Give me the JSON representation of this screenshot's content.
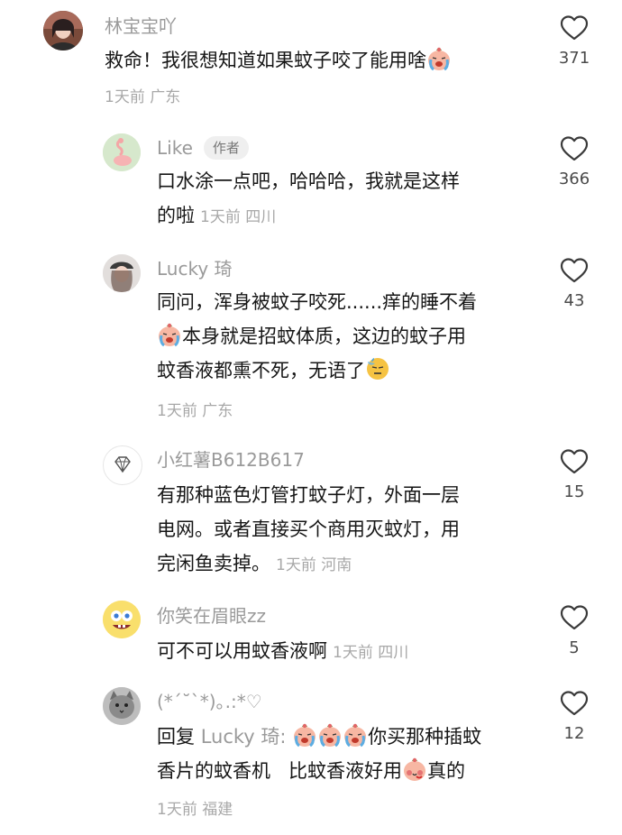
{
  "comments": [
    {
      "user": "林宝宝吖",
      "text": "救命！我很想知道如果蚊子咬了能用啥",
      "meta": "1天前 广东",
      "likes": "371",
      "avatar_icon": "user-photo-avatar"
    },
    {
      "user": "Like",
      "tag": "作者",
      "text_line1": "口水涂一点吧，哈哈哈，我就是这样",
      "text_line2": "的啦",
      "meta": "1天前 四川",
      "likes": "366",
      "avatar_icon": "flamingo-avatar"
    },
    {
      "user": "Lucky 琦",
      "text_line1": "同问，浑身被蚊子咬死......痒的睡不着",
      "text_line2": "本身就是招蚊体质，这边的蚊子用",
      "text_line3": "蚊香液都熏不死，无语了",
      "meta": "1天前 广东",
      "likes": "43",
      "avatar_icon": "girl-cap-avatar"
    },
    {
      "user": "小红薯B612B617",
      "text_line1": "有那种蓝色灯管打蚊子灯，外面一层",
      "text_line2": "电网。或者直接买个商用灭蚊灯，用",
      "text_line3": "完闲鱼卖掉。",
      "meta": "1天前 河南",
      "likes": "15",
      "avatar_icon": "diamond-avatar"
    },
    {
      "user": "你笑在眉眼zz",
      "text": "可不可以用蚊香液啊",
      "meta": "1天前 四川",
      "likes": "5",
      "avatar_icon": "spongebob-avatar"
    },
    {
      "user": "(*ˊ˘ˋ*)｡.:*♡",
      "reply_prefix": "回复",
      "reply_to": "Lucky 琦:",
      "text_line1_after": "你买那种插蚊",
      "text_line2": "香片的蚊香机   比蚊香液好用",
      "text_line2_after": "真的",
      "meta": "1天前 福建",
      "likes": "12",
      "avatar_icon": "cat-avatar"
    }
  ],
  "colors": {
    "name": "#9a9a9a",
    "text": "#161616",
    "meta": "#a8a8a8"
  }
}
